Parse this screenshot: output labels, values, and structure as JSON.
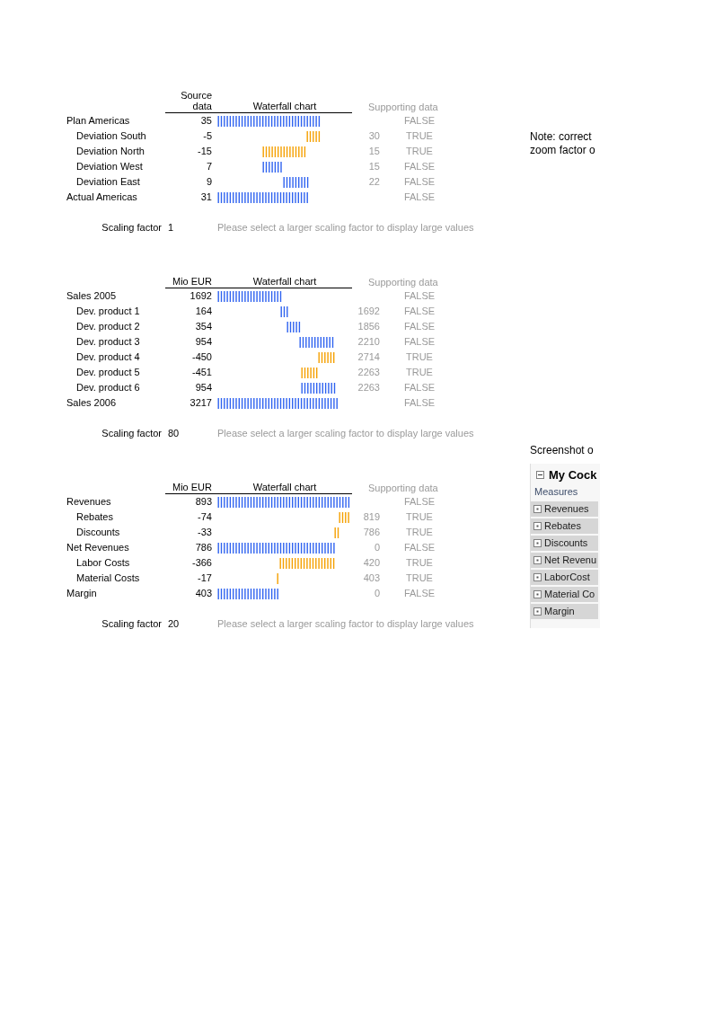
{
  "tables": [
    {
      "value_header": "Source data",
      "chart_header": "Waterfall chart",
      "support_header": "Supporting data",
      "scaling_label": "Scaling factor",
      "scaling_factor": "1",
      "message": "Please select a larger scaling factor to display large values",
      "rows": [
        {
          "label": "Plan Americas",
          "indented": false,
          "value": "35",
          "decrease": false,
          "flag": "FALSE"
        },
        {
          "label": "Deviation South",
          "indented": true,
          "value": "-5",
          "support": "30",
          "decrease": true,
          "flag": "TRUE"
        },
        {
          "label": "Deviation North",
          "indented": true,
          "value": "-15",
          "support": "15",
          "decrease": true,
          "flag": "TRUE"
        },
        {
          "label": "Deviation West",
          "indented": true,
          "value": "7",
          "support": "15",
          "decrease": false,
          "flag": "FALSE"
        },
        {
          "label": "Deviation East",
          "indented": true,
          "value": "9",
          "support": "22",
          "decrease": false,
          "flag": "FALSE"
        },
        {
          "label": "Actual Americas",
          "indented": false,
          "value": "31",
          "decrease": false,
          "flag": "FALSE"
        }
      ]
    },
    {
      "value_header": "Mio EUR",
      "chart_header": "Waterfall chart",
      "support_header": "Supporting data",
      "scaling_label": "Scaling factor",
      "scaling_factor": "80",
      "message": "Please select a larger scaling factor to display large values",
      "rows": [
        {
          "label": "Sales 2005",
          "indented": false,
          "value": "1692",
          "decrease": false,
          "flag": "FALSE"
        },
        {
          "label": "Dev. product 1",
          "indented": true,
          "value": "164",
          "support": "1692",
          "decrease": false,
          "flag": "FALSE"
        },
        {
          "label": "Dev. product 2",
          "indented": true,
          "value": "354",
          "support": "1856",
          "decrease": false,
          "flag": "FALSE"
        },
        {
          "label": "Dev. product 3",
          "indented": true,
          "value": "954",
          "support": "2210",
          "decrease": false,
          "flag": "FALSE"
        },
        {
          "label": "Dev. product 4",
          "indented": true,
          "value": "-450",
          "support": "2714",
          "decrease": true,
          "flag": "TRUE"
        },
        {
          "label": "Dev. product 5",
          "indented": true,
          "value": "-451",
          "support": "2263",
          "decrease": true,
          "flag": "TRUE"
        },
        {
          "label": "Dev. product 6",
          "indented": true,
          "value": "954",
          "support": "2263",
          "decrease": false,
          "flag": "FALSE"
        },
        {
          "label": "Sales 2006",
          "indented": false,
          "value": "3217",
          "decrease": false,
          "flag": "FALSE"
        }
      ]
    },
    {
      "value_header": "Mio EUR",
      "chart_header": "Waterfall chart",
      "support_header": "Supporting data",
      "scaling_label": "Scaling factor",
      "scaling_factor": "20",
      "message": "Please select a larger scaling factor to display large values",
      "rows": [
        {
          "label": "Revenues",
          "indented": false,
          "value": "893",
          "decrease": false,
          "flag": "FALSE"
        },
        {
          "label": "Rebates",
          "indented": true,
          "value": "-74",
          "support": "819",
          "decrease": true,
          "flag": "TRUE"
        },
        {
          "label": "Discounts",
          "indented": true,
          "value": "-33",
          "support": "786",
          "decrease": true,
          "flag": "TRUE"
        },
        {
          "label": "Net Revenues",
          "indented": false,
          "value": "786",
          "support": "0",
          "decrease": false,
          "flag": "FALSE"
        },
        {
          "label": "Labor Costs",
          "indented": true,
          "value": "-366",
          "support": "420",
          "decrease": true,
          "flag": "TRUE"
        },
        {
          "label": "Material Costs",
          "indented": true,
          "value": "-17",
          "support": "403",
          "decrease": true,
          "flag": "TRUE"
        },
        {
          "label": "Margin",
          "indented": false,
          "value": "403",
          "support": "0",
          "decrease": false,
          "flag": "FALSE"
        }
      ]
    }
  ],
  "note": [
    "Note: correct",
    "zoom factor o"
  ],
  "screenshot_caption": "Screenshot o",
  "cockpit": {
    "title": "My Cock",
    "measures_label": "Measures",
    "items": [
      "Revenues",
      "Rebates",
      "Discounts",
      "Net Revenu",
      "LaborCost",
      "Material Co",
      "Margin"
    ]
  }
}
